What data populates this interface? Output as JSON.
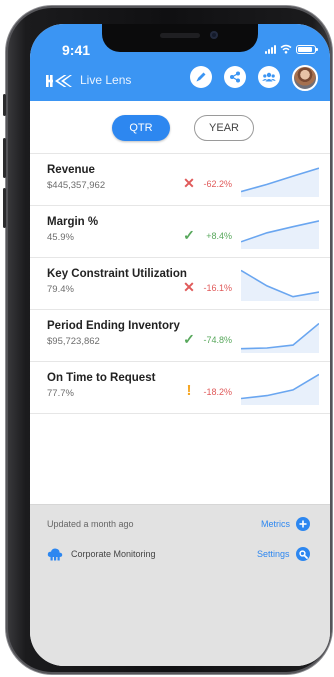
{
  "status_bar": {
    "time": "9:41"
  },
  "app": {
    "title": "Live Lens",
    "header_icons": [
      "edit-pen-icon",
      "share-icon",
      "group-icon",
      "profile-avatar"
    ]
  },
  "period_tabs": [
    {
      "label": "QTR",
      "selected": true
    },
    {
      "label": "YEAR",
      "selected": false
    }
  ],
  "metrics": [
    {
      "name": "Revenue",
      "value": "$445,357,962",
      "status_icon": "x-icon",
      "change": "-62.2%",
      "change_color": "#e05a5a",
      "trend": [
        0.15,
        0.35,
        0.58,
        0.8
      ]
    },
    {
      "name": "Margin %",
      "value": "45.9%",
      "status_icon": "check-icon",
      "change": "+8.4%",
      "change_color": "#58a85c",
      "trend": [
        0.2,
        0.45,
        0.62,
        0.78
      ]
    },
    {
      "name": "Key Constraint Utilization",
      "value": "79.4%",
      "status_icon": "x-icon",
      "change": "-16.1%",
      "change_color": "#e05a5a",
      "trend": [
        0.85,
        0.42,
        0.12,
        0.25
      ]
    },
    {
      "name": "Period Ending Inventory",
      "value": "$95,723,862",
      "status_icon": "check-icon",
      "change": "-74.8%",
      "change_color": "#58a85c",
      "trend": [
        0.12,
        0.14,
        0.22,
        0.82
      ]
    },
    {
      "name": "On Time to Request",
      "value": "77.7%",
      "status_icon": "exclamation-icon",
      "change": "-18.2%",
      "change_color": "#e05a5a",
      "trend": [
        0.18,
        0.26,
        0.42,
        0.85
      ]
    }
  ],
  "footer": {
    "updated": "Updated a month ago",
    "metrics_link": "Metrics",
    "corporate_label": "Corporate Monitoring",
    "settings_link": "Settings"
  },
  "colors": {
    "header": "#3b95f3",
    "accent": "#2d87f0",
    "bad": "#e05a5a",
    "good": "#58a85c",
    "warning": "#f5a623",
    "sparkline": "#6aa6f0",
    "sparkline_fill": "#e8f0fb"
  }
}
